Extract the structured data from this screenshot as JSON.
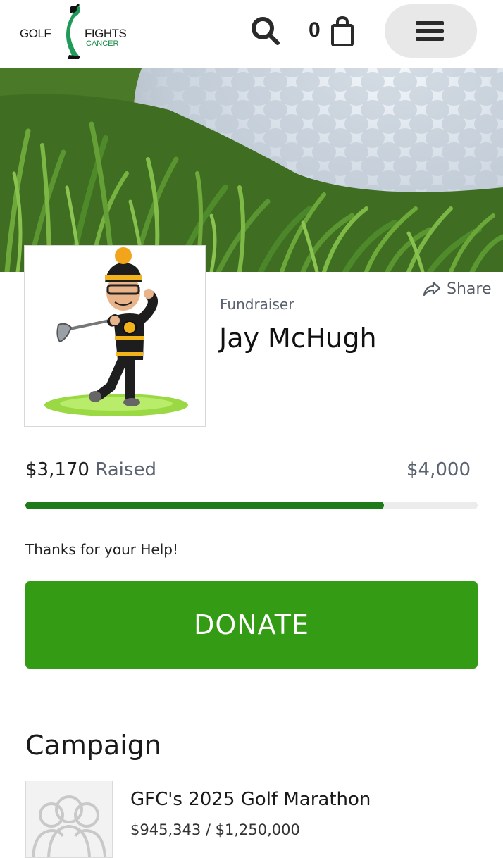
{
  "header": {
    "logo": {
      "line1": "GOLF",
      "line2": "FIGHTS",
      "line3": "CANCER"
    },
    "search_icon": "search-icon",
    "cart_count": "0",
    "cart_icon": "shopping-bag-icon",
    "menu_icon": "hamburger-menu-icon"
  },
  "banner": {
    "image": "golf-ball-on-grass"
  },
  "profile": {
    "share_label": "Share",
    "role": "Fundraiser",
    "name": "Jay McHugh"
  },
  "progress": {
    "raised_amount": "$3,170",
    "raised_label": "Raised",
    "goal_amount": "$4,000",
    "fraction": 0.7925
  },
  "message": "Thanks for your Help!",
  "donate_label": "DONATE",
  "campaign": {
    "heading": "Campaign",
    "title": "GFC's 2025 Golf Marathon",
    "amounts": "$945,343 / $1,250,000"
  },
  "colors": {
    "donate": "#339c14",
    "progress_fill": "#1f7a1a",
    "brand_green": "#1a8a4a"
  }
}
